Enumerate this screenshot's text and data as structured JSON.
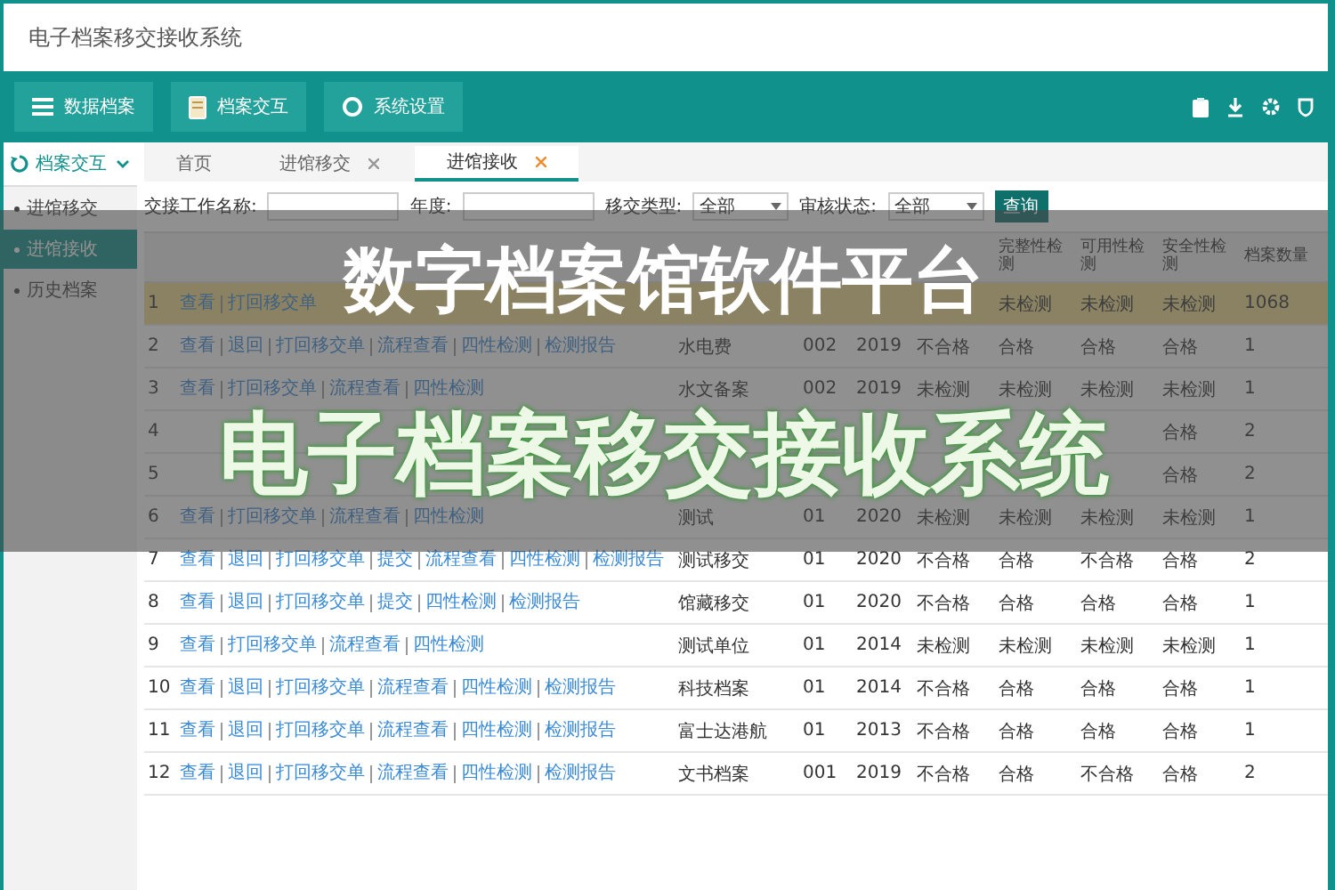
{
  "window": {
    "title": "电子档案移交接收系统"
  },
  "toolbar": {
    "buttons": [
      {
        "label": "数据档案"
      },
      {
        "label": "档案交互"
      },
      {
        "label": "系统设置"
      }
    ]
  },
  "sidebar": {
    "group": {
      "label": "档案交互",
      "expanded": true
    },
    "items": [
      {
        "label": "进馆移交",
        "selected": false
      },
      {
        "label": "进馆接收",
        "selected": true
      },
      {
        "label": "历史档案",
        "selected": false
      }
    ]
  },
  "tabs": [
    {
      "label": "首页",
      "selected": false,
      "closable": false
    },
    {
      "label": "进馆移交",
      "selected": false,
      "closable": true
    },
    {
      "label": "进馆接收",
      "selected": true,
      "closable": true
    }
  ],
  "filters": [
    {
      "kind": "text",
      "label": "交接工作名称:"
    },
    {
      "kind": "text",
      "label": "年度:"
    },
    {
      "kind": "select",
      "label": "移交类型:",
      "value": "全部"
    },
    {
      "kind": "select",
      "label": "审核状态:",
      "value": "全部"
    }
  ],
  "search_button": "查询",
  "table": {
    "columns": [
      "完整性检测",
      "可用性检测",
      "安全性检测",
      "档案数量"
    ],
    "rows": [
      {
        "index": "1",
        "selected": true,
        "actions": [
          "查看",
          "打回移交单"
        ],
        "check_2": "未检测",
        "check_3": "未检测",
        "check_4": "未检测",
        "count": "1068"
      },
      {
        "index": "2",
        "selected": false,
        "actions": [
          "查看",
          "退回",
          "打回移交单",
          "流程查看",
          "四性检测",
          "检测报告"
        ],
        "name": "水电费",
        "code": "002",
        "year": "2019",
        "checks": [
          "不合格",
          "合格",
          "合格",
          "合格"
        ],
        "count": "1"
      },
      {
        "index": "3",
        "selected": false,
        "actions": [
          "查看",
          "打回移交单",
          "流程查看",
          "四性检测"
        ],
        "name": "水文备案",
        "code": "002",
        "year": "2019",
        "checks": [
          "未检测",
          "未检测",
          "未检测",
          "未检测"
        ],
        "count": "1"
      },
      {
        "index": "4",
        "selected": false,
        "check_4": "合格",
        "count": "2"
      },
      {
        "index": "5",
        "selected": false,
        "check_4": "合格",
        "count": "2"
      },
      {
        "index": "6",
        "selected": false,
        "actions": [
          "查看",
          "打回移交单",
          "流程查看",
          "四性检测"
        ],
        "name": "测试",
        "code": "01",
        "year": "2020",
        "checks": [
          "未检测",
          "未检测",
          "未检测",
          "未检测"
        ],
        "count": "1"
      },
      {
        "index": "7",
        "selected": false,
        "actions": [
          "查看",
          "退回",
          "打回移交单",
          "提交",
          "流程查看",
          "四性检测",
          "检测报告"
        ],
        "name": "测试移交",
        "code": "01",
        "year": "2020",
        "checks": [
          "不合格",
          "合格",
          "不合格",
          "合格"
        ],
        "count": "2"
      },
      {
        "index": "8",
        "selected": false,
        "actions": [
          "查看",
          "退回",
          "打回移交单",
          "提交",
          "四性检测",
          "检测报告"
        ],
        "name": "馆藏移交",
        "code": "01",
        "year": "2020",
        "checks": [
          "不合格",
          "合格",
          "合格",
          "合格"
        ],
        "count": "1"
      },
      {
        "index": "9",
        "selected": false,
        "actions": [
          "查看",
          "打回移交单",
          "流程查看",
          "四性检测"
        ],
        "name": "测试单位",
        "code": "01",
        "year": "2014",
        "checks": [
          "未检测",
          "未检测",
          "未检测",
          "未检测"
        ],
        "count": "1"
      },
      {
        "index": "10",
        "selected": false,
        "actions": [
          "查看",
          "退回",
          "打回移交单",
          "流程查看",
          "四性检测",
          "检测报告"
        ],
        "name": "科技档案",
        "code": "01",
        "year": "2014",
        "checks": [
          "不合格",
          "合格",
          "合格",
          "合格"
        ],
        "count": "1"
      },
      {
        "index": "11",
        "selected": false,
        "actions": [
          "查看",
          "退回",
          "打回移交单",
          "流程查看",
          "四性检测",
          "检测报告"
        ],
        "name": "富士达港航",
        "code": "01",
        "year": "2013",
        "checks": [
          "不合格",
          "合格",
          "合格",
          "合格"
        ],
        "count": "1"
      },
      {
        "index": "12",
        "selected": false,
        "actions": [
          "查看",
          "退回",
          "打回移交单",
          "流程查看",
          "四性检测",
          "检测报告"
        ],
        "name": "文书档案",
        "code": "001",
        "year": "2019",
        "checks": [
          "不合格",
          "合格",
          "不合格",
          "合格"
        ],
        "count": "2"
      }
    ]
  },
  "banner": {
    "title": "数字档案馆软件平台",
    "subtitle": "电子档案移交接收系统"
  }
}
